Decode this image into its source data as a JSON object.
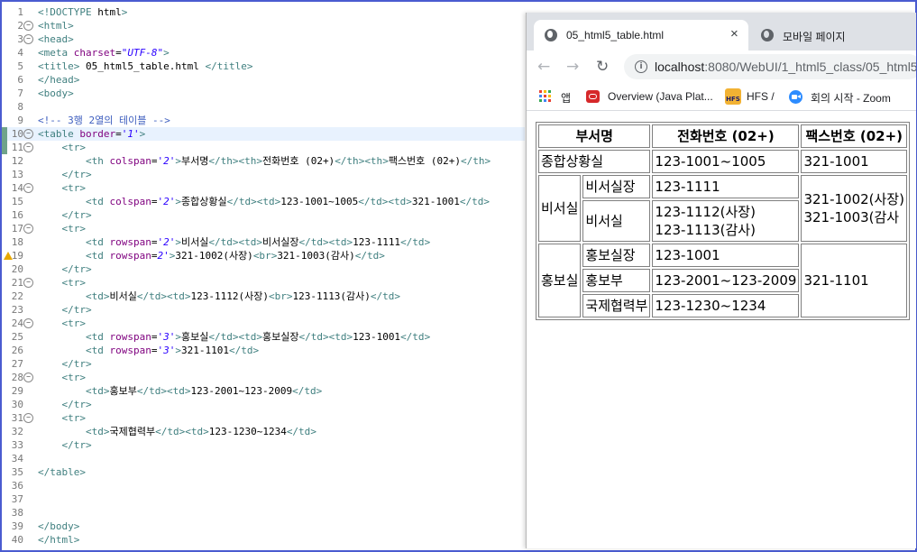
{
  "editor": {
    "line_numbers": [
      "1",
      "2",
      "3",
      "4",
      "5",
      "6",
      "7",
      "8",
      "9",
      "10",
      "11",
      "12",
      "13",
      "14",
      "15",
      "16",
      "17",
      "18",
      "19",
      "20",
      "21",
      "22",
      "23",
      "24",
      "25",
      "26",
      "27",
      "28",
      "29",
      "30",
      "31",
      "32",
      "33",
      "34",
      "35",
      "36",
      "37",
      "38",
      "39",
      "40"
    ],
    "lines": [
      "<!DOCTYPE html>",
      "<html>",
      "<head>",
      "<meta charset=\"UTF-8\">",
      "<title> 05_html5_table.html </title>",
      "</head>",
      "<body>",
      "",
      "<!-- 3행 2열의 테이블 -->",
      "<table border='1'>",
      "    <tr>",
      "        <th colspan='2'>부서명</th><th>전화번호 (02+)</th><th>팩스번호 (02+)</th>",
      "    </tr>",
      "    <tr>",
      "        <td colspan='2'>종합상황실</td><td>123-1001~1005</td><td>321-1001</td>",
      "    </tr>",
      "    <tr>",
      "        <td rowspan='2'>비서실</td><td>비서실장</td><td>123-1111</td>",
      "        <td rowspan=2'>321-1002(사장)<br>321-1003(감사)</td>",
      "    </tr>",
      "    <tr>",
      "        <td>비서실</td><td>123-1112(사장)<br>123-1113(감사)</td>",
      "    </tr>",
      "    <tr>",
      "        <td rowspan='3'>홍보실</td><td>홍보실장</td><td>123-1001</td>",
      "        <td rowspan='3'>321-1101</td>",
      "    </tr>",
      "    <tr>",
      "        <td>홍보부</td><td>123-2001~123-2009</td>",
      "    </tr>",
      "    <tr>",
      "        <td>국제협력부</td><td>123-1230~1234</td>",
      "    </tr>",
      "",
      "</table>",
      "",
      "",
      "",
      "</body>",
      "</html>"
    ]
  },
  "browser": {
    "tabs": [
      {
        "title": "05_html5_table.html",
        "close": "×"
      },
      {
        "title": "모바일 페이지"
      }
    ],
    "nav": {
      "back": "←",
      "forward": "→",
      "reload": "↻"
    },
    "address": {
      "host": "localhost",
      "rest": ":8080/WebUI/1_html5_class/05_html5"
    },
    "bookmarks": [
      {
        "label": "앱",
        "icon": "apps-grid-icon"
      },
      {
        "label": "Overview (Java Plat...",
        "icon": "oracle-icon"
      },
      {
        "label": "HFS /",
        "icon": "hfs-icon",
        "icon_text": "HFS"
      },
      {
        "label": "회의 시작 - Zoom",
        "icon": "zoom-icon"
      }
    ],
    "table": {
      "headers": [
        "부서명",
        "전화번호 (02+)",
        "팩스번호 (02+)"
      ],
      "row1": {
        "dept": "종합상황실",
        "phone": "123-1001~1005",
        "fax": "321-1001"
      },
      "secretary": {
        "group": "비서실",
        "sub1": "비서실장",
        "phone1": "123-1111",
        "fax_a": "321-1002(사장)",
        "fax_b": "321-1003(감사",
        "sub2": "비서실",
        "phone2a": "123-1112(사장)",
        "phone2b": "123-1113(감사)"
      },
      "pr": {
        "group": "홍보실",
        "sub1": "홍보실장",
        "phone1": "123-1001",
        "fax": "321-1101",
        "sub2": "홍보부",
        "phone2": "123-2001~123-2009",
        "sub3": "국제협력부",
        "phone3": "123-1230~1234"
      }
    }
  },
  "colors": {
    "frame_border": "#4a5bd0",
    "tag": "#3f7f7f",
    "attribute": "#7f007f",
    "value": "#2a00ff",
    "comment": "#3f5fbf",
    "current_line": "#e8f2fe"
  }
}
